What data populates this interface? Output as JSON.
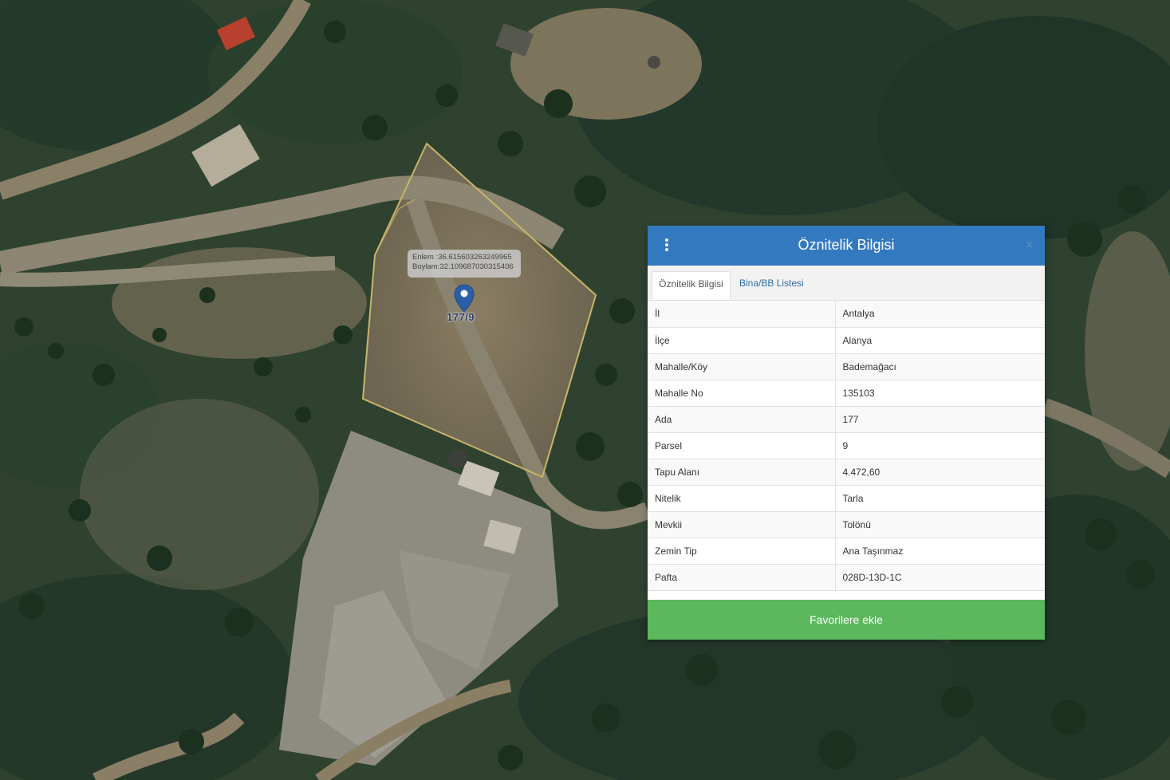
{
  "map": {
    "coord_tooltip": {
      "lat_line": "Enlem :36.615603263249965",
      "lon_line": "Boylam:32.109687030315406"
    },
    "parcel_label": "177/9",
    "marker_icon": "map-marker-icon",
    "parcel_outline_color": "#c8b46a"
  },
  "panel": {
    "title": "Öznitelik Bilgisi",
    "menu_icon": "vertical-dots-icon",
    "close_icon": "close-icon",
    "close_glyph": "×",
    "header_color": "#3379bf",
    "tabs": [
      {
        "label": "Öznitelik Bilgisi",
        "active": true
      },
      {
        "label": "Bina/BB Listesi",
        "active": false
      }
    ],
    "rows": [
      {
        "key": "İl",
        "value": "Antalya"
      },
      {
        "key": "İlçe",
        "value": "Alanya"
      },
      {
        "key": "Mahalle/Köy",
        "value": "Bademağacı"
      },
      {
        "key": "Mahalle No",
        "value": "135103"
      },
      {
        "key": "Ada",
        "value": "177"
      },
      {
        "key": "Parsel",
        "value": "9"
      },
      {
        "key": "Tapu Alanı",
        "value": "4.472,60"
      },
      {
        "key": "Nitelik",
        "value": "Tarla"
      },
      {
        "key": "Mevkii",
        "value": "Tolönü"
      },
      {
        "key": "Zemin Tip",
        "value": "Ana Taşınmaz"
      },
      {
        "key": "Pafta",
        "value": "028D-13D-1C"
      }
    ],
    "favorite_button": "Favorilere ekle",
    "favorite_color": "#5cb85c"
  }
}
